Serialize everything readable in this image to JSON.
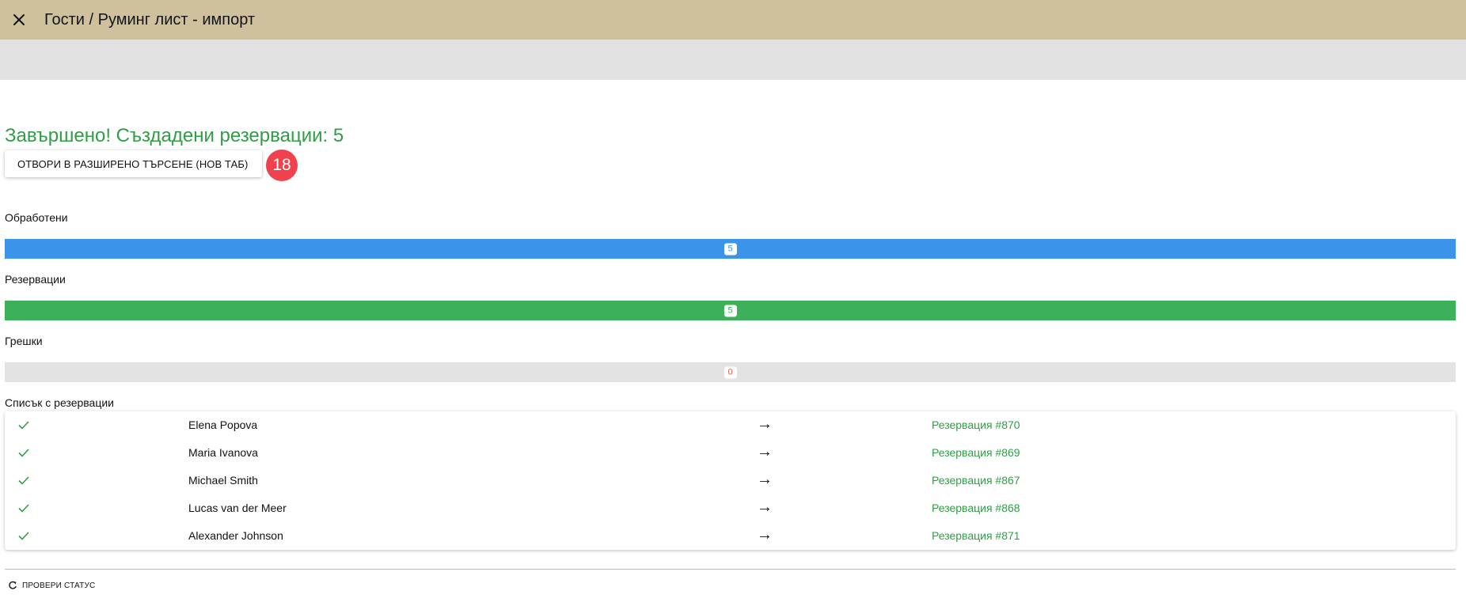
{
  "header": {
    "title": "Гости / Руминг лист - импорт",
    "close_icon": "close-icon"
  },
  "result": {
    "heading": "Завършено! Създадени резервации: 5",
    "open_button_label": "ОТВОРИ В РАЗШИРЕНО ТЪРСЕНЕ (НОВ ТАБ)",
    "badge_count": "18"
  },
  "progress": {
    "processed": {
      "label": "Обработени",
      "value": "5",
      "fill_fraction": 1.0,
      "color": "#3b93ea"
    },
    "reservations": {
      "label": "Резервации",
      "value": "5",
      "fill_fraction": 1.0,
      "color": "#3db05a"
    },
    "errors": {
      "label": "Грешки",
      "value": "0",
      "fill_fraction": 0.0,
      "color": "#e95b4f"
    }
  },
  "list": {
    "title": "Списък с резервации",
    "arrow": "→",
    "rows": [
      {
        "name": "Elena Popova",
        "reservation": "Резервация #870"
      },
      {
        "name": "Maria Ivanova",
        "reservation": "Резервация #869"
      },
      {
        "name": "Michael Smith",
        "reservation": "Резервация #867"
      },
      {
        "name": "Lucas van der Meer",
        "reservation": "Резервация #868"
      },
      {
        "name": "Alexander Johnson",
        "reservation": "Резервация #871"
      }
    ]
  },
  "footer": {
    "check_status_label": "ПРОВЕРИ СТАТУС",
    "refresh_icon": "refresh-icon"
  },
  "colors": {
    "header_bg": "#cfc19d",
    "subbar_bg": "#e1e1e1",
    "success_green": "#2f9e44",
    "badge_red": "#f0424c",
    "track_gray": "#e3e3e3"
  }
}
